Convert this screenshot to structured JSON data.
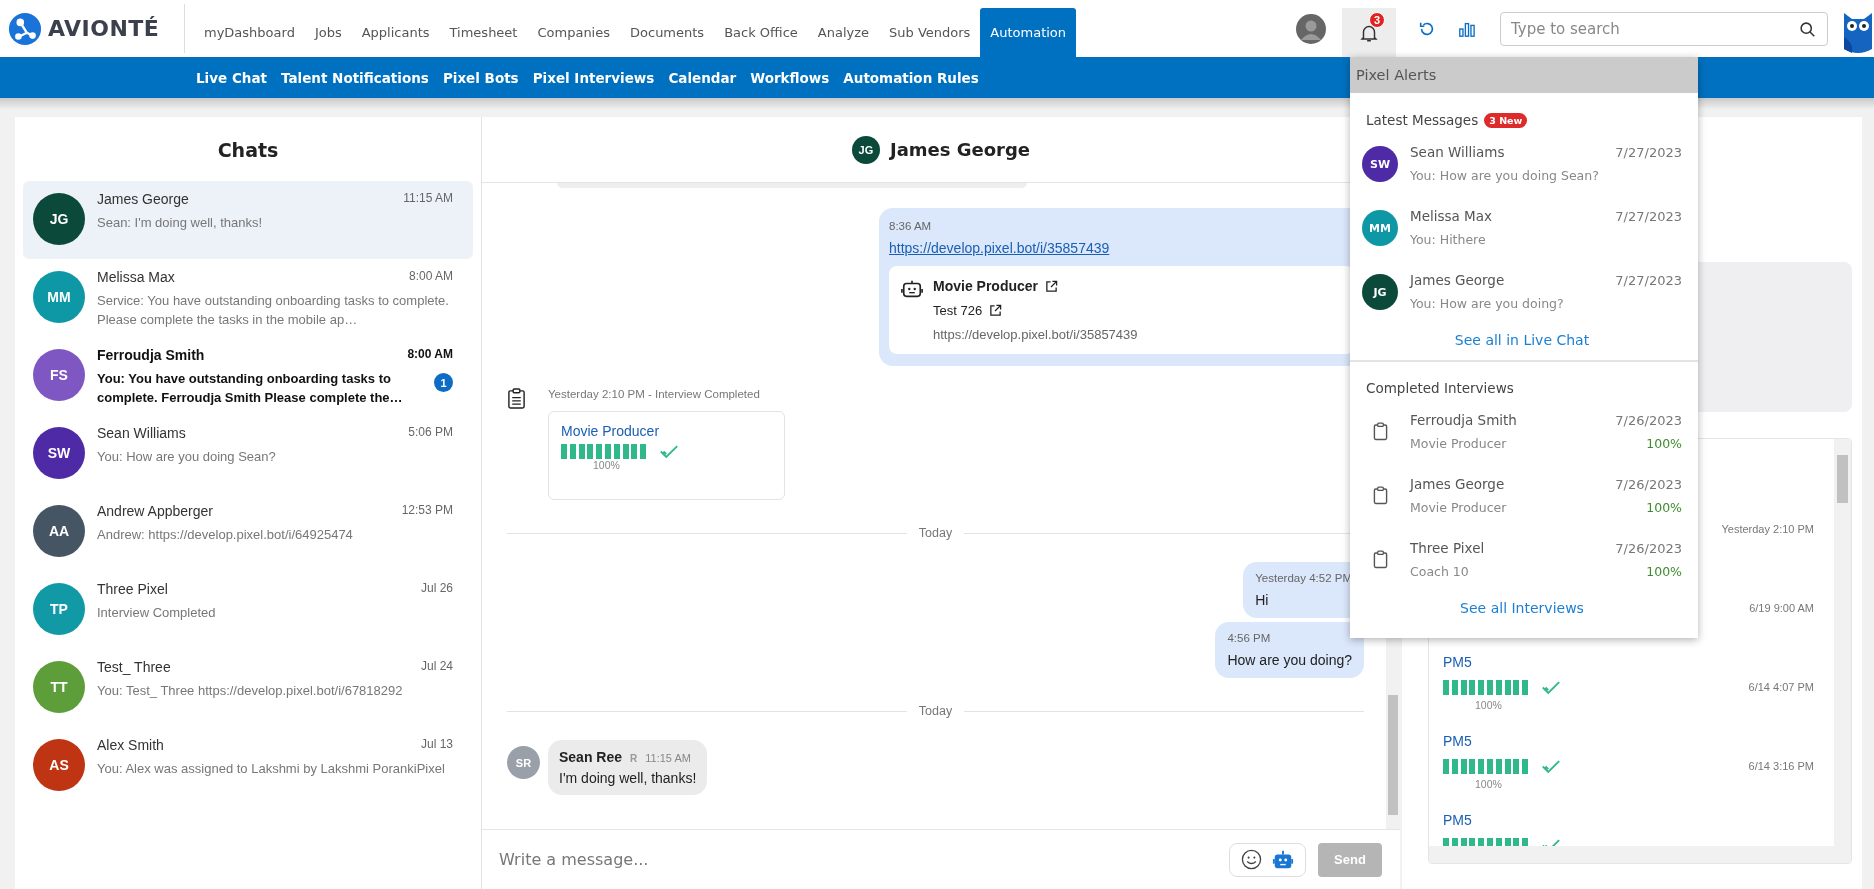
{
  "brand": {
    "name": "AVIONTÉ"
  },
  "nav": [
    {
      "label": "myDashboard",
      "selected": false
    },
    {
      "label": "Jobs",
      "selected": false
    },
    {
      "label": "Applicants",
      "selected": false
    },
    {
      "label": "Timesheet",
      "selected": false
    },
    {
      "label": "Companies",
      "selected": false
    },
    {
      "label": "Documents",
      "selected": false
    },
    {
      "label": "Back Office",
      "selected": false
    },
    {
      "label": "Analyze",
      "selected": false
    },
    {
      "label": "Sub Vendors",
      "selected": false
    },
    {
      "label": "Automation",
      "selected": true
    }
  ],
  "subnav": [
    {
      "label": "Live Chat"
    },
    {
      "label": "Talent Notifications"
    },
    {
      "label": "Pixel Bots"
    },
    {
      "label": "Pixel Interviews"
    },
    {
      "label": "Calendar"
    },
    {
      "label": "Workflows"
    },
    {
      "label": "Automation Rules"
    }
  ],
  "header": {
    "alerts_open": true,
    "notification_count": "3",
    "search_placeholder": "Type to search"
  },
  "chats": {
    "title": "Chats",
    "items": [
      {
        "initials": "JG",
        "color": "#0b4a3b",
        "name": "James George",
        "time": "11:15 AM",
        "preview": "Sean: I'm doing well, thanks!",
        "unread": false,
        "selected": true
      },
      {
        "initials": "MM",
        "color": "#0e98a6",
        "name": "Melissa Max",
        "time": "8:00 AM",
        "preview": "Service: You have outstanding onboarding tasks to complete. Please complete the tasks in the mobile ap…",
        "unread": false,
        "selected": false
      },
      {
        "initials": "FS",
        "color": "#7e57c2",
        "name": "Ferroudja Smith",
        "time": "8:00 AM",
        "preview": "You: You have outstanding onboarding tasks to complete. Ferroudja Smith Please complete the…",
        "unread": true,
        "badge": "1",
        "selected": false
      },
      {
        "initials": "SW",
        "color": "#4f2aa6",
        "name": "Sean Williams",
        "time": "5:06 PM",
        "preview": "You: How are you doing Sean?",
        "unread": false,
        "selected": false
      },
      {
        "initials": "AA",
        "color": "#455564",
        "name": "Andrew Appberger",
        "time": "12:53 PM",
        "preview": "Andrew: https://develop.pixel.bot/i/64925474",
        "unread": false,
        "selected": false
      },
      {
        "initials": "TP",
        "color": "#1199a5",
        "name": "Three Pixel",
        "time": "Jul 26",
        "preview": "Interview Completed",
        "unread": false,
        "selected": false
      },
      {
        "initials": "TT",
        "color": "#5e9e3a",
        "name": "Test_ Three",
        "time": "Jul 24",
        "preview": "You: Test_ Three https://develop.pixel.bot/i/67818292",
        "unread": false,
        "selected": false
      },
      {
        "initials": "AS",
        "color": "#bf3412",
        "name": "Alex Smith",
        "time": "Jul 13",
        "preview": "You: Alex was assigned to Lakshmi by Lakshmi PorankiPixel",
        "unread": false,
        "selected": false
      }
    ]
  },
  "conversation": {
    "initials": "JG",
    "color": "#0b4a3b",
    "name": "James George",
    "messages": [
      {
        "kind": "outgoing_link",
        "time": "8:36 AM",
        "link": "https://develop.pixel.bot/i/35857439",
        "card": {
          "title": "Movie Producer",
          "subtitle": "Test 726",
          "url": "https://develop.pixel.bot/i/35857439"
        }
      },
      {
        "kind": "interview",
        "caption": "Yesterday 2:10 PM - Interview Completed",
        "title": "Movie Producer",
        "level": 1,
        "percent": "100%"
      },
      {
        "kind": "divider",
        "label": "Today"
      },
      {
        "kind": "outgoing",
        "time": "Yesterday 4:52 PM",
        "text": "Hi"
      },
      {
        "kind": "outgoing",
        "time": "4:56 PM",
        "text": "How are you doing?"
      },
      {
        "kind": "divider",
        "label": "Today"
      },
      {
        "kind": "incoming",
        "initials": "SR",
        "sender": "Sean Ree",
        "role": "R",
        "time": "11:15 AM",
        "text": "I'm doing well, thanks!"
      }
    ],
    "composer": {
      "placeholder": "Write a message...",
      "send_label": "Send",
      "send_disabled": true
    }
  },
  "alerts": {
    "title": "Pixel Alerts",
    "messages_heading": "Latest Messages",
    "new_badge": "3 New",
    "messages": [
      {
        "initials": "SW",
        "color": "#4f2aa6",
        "name": "Sean Williams",
        "date": "7/27/2023",
        "preview": "You: How are you doing Sean?"
      },
      {
        "initials": "MM",
        "color": "#0e98a6",
        "name": "Melissa Max",
        "date": "7/27/2023",
        "preview": "You: Hithere"
      },
      {
        "initials": "JG",
        "color": "#0b4a3b",
        "name": "James George",
        "date": "7/27/2023",
        "preview": "You: How are you doing?"
      }
    ],
    "messages_link": "See all in Live Chat",
    "interviews_heading": "Completed Interviews",
    "interviews": [
      {
        "name": "Ferroudja Smith",
        "date": "7/26/2023",
        "subtitle": "Movie Producer",
        "percent": "100%"
      },
      {
        "name": "James George",
        "date": "7/26/2023",
        "subtitle": "Movie Producer",
        "percent": "100%"
      },
      {
        "name": "Three Pixel",
        "date": "7/26/2023",
        "subtitle": "Coach 10",
        "percent": "100%"
      }
    ],
    "interviews_link": "See all Interviews"
  },
  "right_panel": {
    "entries": [
      {
        "date": "Yesterday 2:10 PM"
      },
      {
        "date": "6/19 9:00 AM"
      },
      {
        "title": "PM5",
        "level": 1,
        "percent": "100%",
        "date": "6/14 4:07 PM"
      },
      {
        "title": "PM5",
        "level": 1,
        "percent": "100%",
        "date": "6/14 3:16 PM"
      },
      {
        "title": "PM5",
        "level": 1
      }
    ]
  }
}
